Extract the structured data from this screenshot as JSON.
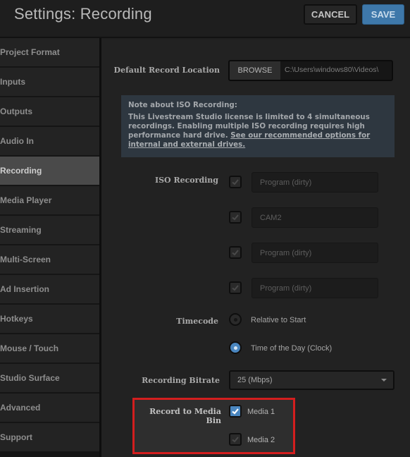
{
  "header": {
    "title": "Settings: Recording",
    "cancel_label": "CANCEL",
    "save_label": "SAVE"
  },
  "sidebar": {
    "active": "Recording",
    "items": [
      {
        "label": "Project Format"
      },
      {
        "label": "Inputs"
      },
      {
        "label": "Outputs"
      },
      {
        "label": "Audio In"
      },
      {
        "label": "Recording"
      },
      {
        "label": "Media Player"
      },
      {
        "label": "Streaming"
      },
      {
        "label": "Multi-Screen"
      },
      {
        "label": "Ad Insertion"
      },
      {
        "label": "Hotkeys"
      },
      {
        "label": "Mouse / Touch"
      },
      {
        "label": "Studio Surface"
      },
      {
        "label": "Advanced"
      },
      {
        "label": "Support"
      }
    ]
  },
  "record_location": {
    "label": "Default Record Location",
    "browse_label": "BROWSE",
    "path": "C:\\Users\\windows80\\Videos\\"
  },
  "note": {
    "title": "Note about ISO Recording:",
    "body": "This Livestream Studio license is limited to 4 simultaneous recordings. Enabling multiple ISO recording requires high performance hard drive. ",
    "link": "See our recommended options for internal and external drives."
  },
  "iso_recording": {
    "label": "ISO Recording",
    "channels": [
      {
        "checked": false,
        "value": "Program (dirty)"
      },
      {
        "checked": false,
        "value": "CAM2"
      },
      {
        "checked": false,
        "value": "Program (dirty)"
      },
      {
        "checked": false,
        "value": "Program (dirty)"
      }
    ]
  },
  "timecode": {
    "label": "Timecode",
    "options": [
      {
        "label": "Relative to Start",
        "selected": false
      },
      {
        "label": "Time of the Day (Clock)",
        "selected": true
      }
    ]
  },
  "bitrate": {
    "label": "Recording Bitrate",
    "value": "25 (Mbps)"
  },
  "media_bin": {
    "label": "Record to Media Bin",
    "options": [
      {
        "label": "Media 1",
        "checked": true
      },
      {
        "label": "Media 2",
        "checked": false
      }
    ],
    "highlight_color": "#d31e1e"
  },
  "colors": {
    "accent": "#4a86bf",
    "save_button": "#3e78aa",
    "note_bg": "#2e3740"
  }
}
